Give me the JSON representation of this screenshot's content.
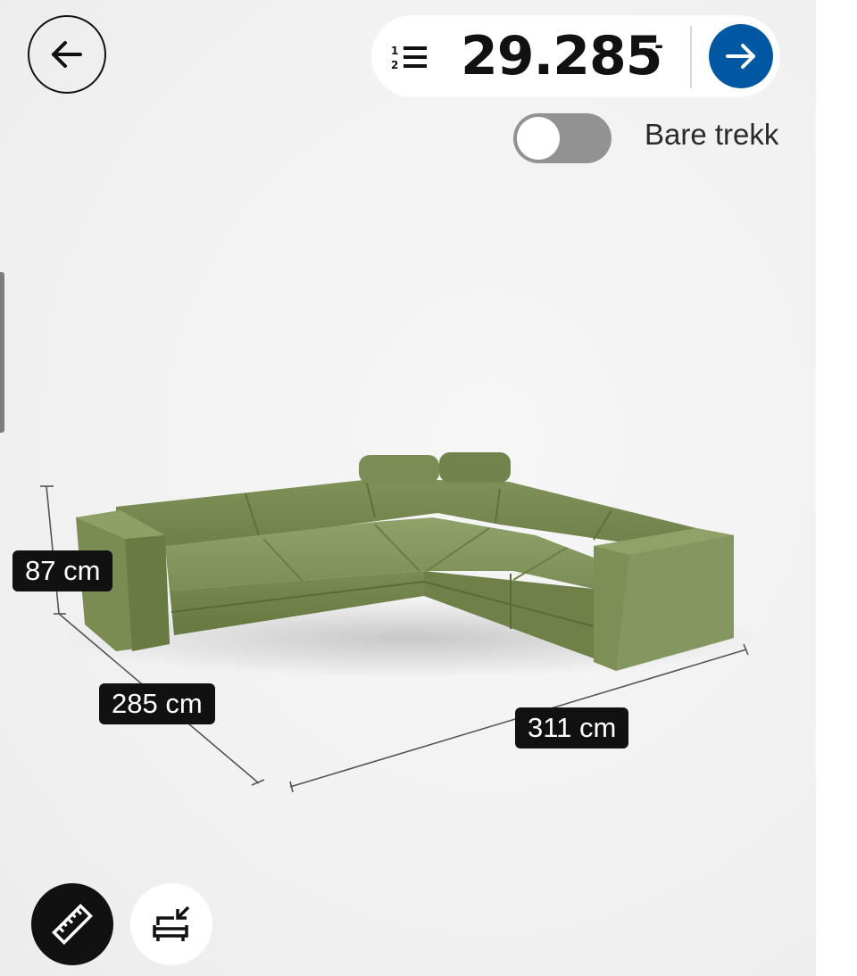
{
  "header": {
    "price": "29.285",
    "price_suffix": ",-"
  },
  "toggle": {
    "label": "Bare trekk",
    "on": false
  },
  "dimensions": {
    "height": "87 cm",
    "depth": "285 cm",
    "width": "311 cm"
  },
  "icons": {
    "back": "arrow-left-icon",
    "list": "numbered-list-icon",
    "next": "arrow-right-icon",
    "measure": "ruler-icon",
    "place": "sofa-place-icon"
  },
  "colors": {
    "accent": "#0058a3",
    "sofa": "#7f9159",
    "badge": "#111111"
  }
}
